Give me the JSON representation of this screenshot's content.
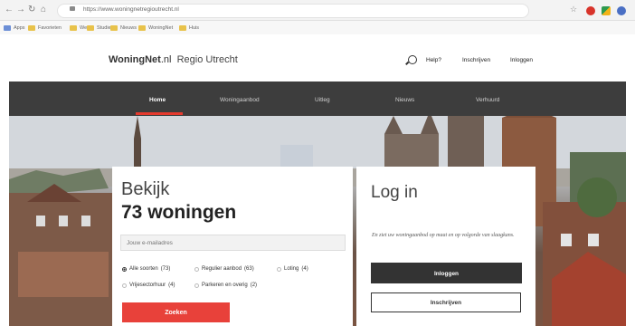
{
  "browser": {
    "url": "https://www.woningnetregioutrecht.nl",
    "bookmarks": [
      "Apps",
      "Favorieten",
      "Werk",
      "Studie",
      "Nieuws",
      "WoningNet",
      "Huis"
    ]
  },
  "header": {
    "brand_bold": "WoningNet",
    "brand_suffix": ".nl",
    "brand_sub": "Regio Utrecht",
    "links": {
      "help": "Help?",
      "register": "Inschrijven",
      "login": "Inloggen"
    }
  },
  "nav": {
    "items": [
      "Home",
      "Woningaanbod",
      "Uitleg",
      "Nieuws",
      "Verhuurd"
    ],
    "active": "Home",
    "accent_color": "#e63a2e"
  },
  "search_card": {
    "heading": "Bekijk",
    "count_text": "73 woningen",
    "email_placeholder": "Jouw e-mailadres",
    "options": [
      {
        "label": "Alle soorten",
        "count": "(73)",
        "selected": true
      },
      {
        "label": "Regulier aanbod",
        "count": "(63)",
        "selected": false
      },
      {
        "label": "Loting",
        "count": "(4)",
        "selected": false
      },
      {
        "label": "Vrijesectorhuur",
        "count": "(4)",
        "selected": false
      },
      {
        "label": "Parkeren en overig",
        "count": "(2)",
        "selected": false
      }
    ],
    "submit_label": "Zoeken",
    "submit_color": "#e8413a"
  },
  "login_card": {
    "title": "Log in",
    "description": "En ziet uw woningaanbod op maat en op volgorde van slaagkans.",
    "login_button": "Inloggen",
    "register_button": "Inschrijven"
  }
}
